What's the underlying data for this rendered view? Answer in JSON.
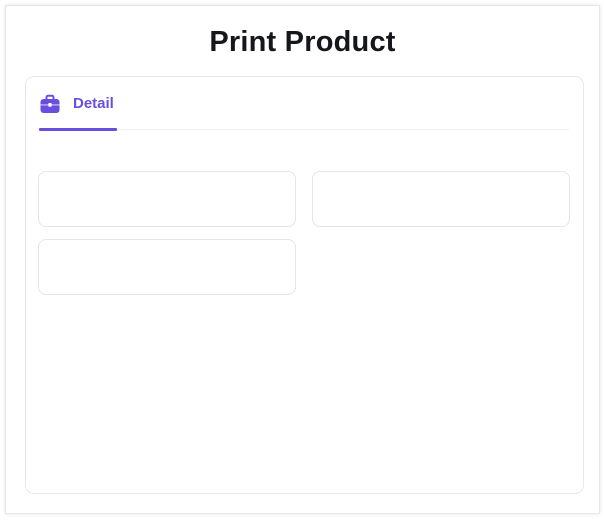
{
  "modal": {
    "title": "Print Product"
  },
  "tabs": [
    {
      "label": "Detail",
      "icon": "briefcase-icon",
      "active": true
    }
  ],
  "fields": [
    {
      "value": "",
      "placeholder": ""
    },
    {
      "value": "",
      "placeholder": ""
    },
    {
      "value": "",
      "placeholder": ""
    }
  ],
  "colors": {
    "accent": "#6a4ee0",
    "title": "#16161d",
    "border": "#e5e5ea"
  }
}
